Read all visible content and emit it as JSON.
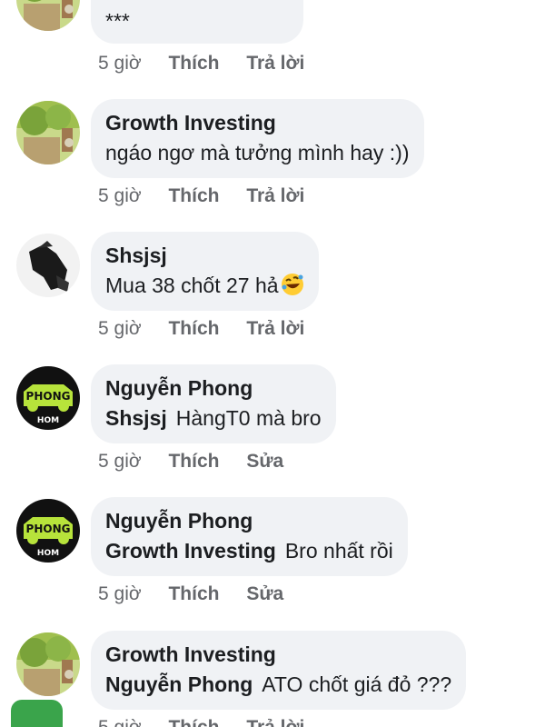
{
  "comments": [
    {
      "author": "",
      "text": "***",
      "time": "5 giờ",
      "like": "Thích",
      "reply": "Trả lời"
    },
    {
      "author": "Growth Investing",
      "text": "ngáo ngơ mà tưởng mình hay :))",
      "time": "5 giờ",
      "like": "Thích",
      "reply": "Trả lời"
    },
    {
      "author": "Shsjsj",
      "text": "Mua 38 chốt 27 hả",
      "emoji": "rolling-on-floor-laughing-emoji",
      "time": "5 giờ",
      "like": "Thích",
      "reply": "Trả lời"
    },
    {
      "author": "Nguyễn Phong",
      "mention": "Shsjsj",
      "text": "HàngT0 mà bro",
      "time": "5 giờ",
      "like": "Thích",
      "edit": "Sửa"
    },
    {
      "author": "Nguyễn Phong",
      "mention": "Growth Investing",
      "text": "Bro nhất rồi",
      "time": "5 giờ",
      "like": "Thích",
      "edit": "Sửa"
    },
    {
      "author": "Growth Investing",
      "mention": "Nguyễn Phong",
      "text": "ATO chốt giá đỏ ???",
      "time": "5 giờ",
      "like": "Thích",
      "reply": "Trả lời"
    }
  ],
  "avatars": {
    "growth_investing": "garden-photo-avatar",
    "shsjsj": "black-figure-avatar",
    "nguyen_phong": "phong-logo-avatar",
    "phong_logo_text": "PHONG",
    "phong_logo_subtext": "HOM"
  },
  "fab": {
    "icon": "chat-bubble-icon"
  },
  "colors": {
    "bubble": "#f0f2f5",
    "action_text": "#65676b",
    "fab": "#3aa44b",
    "logo_green": "#b7e33b"
  }
}
